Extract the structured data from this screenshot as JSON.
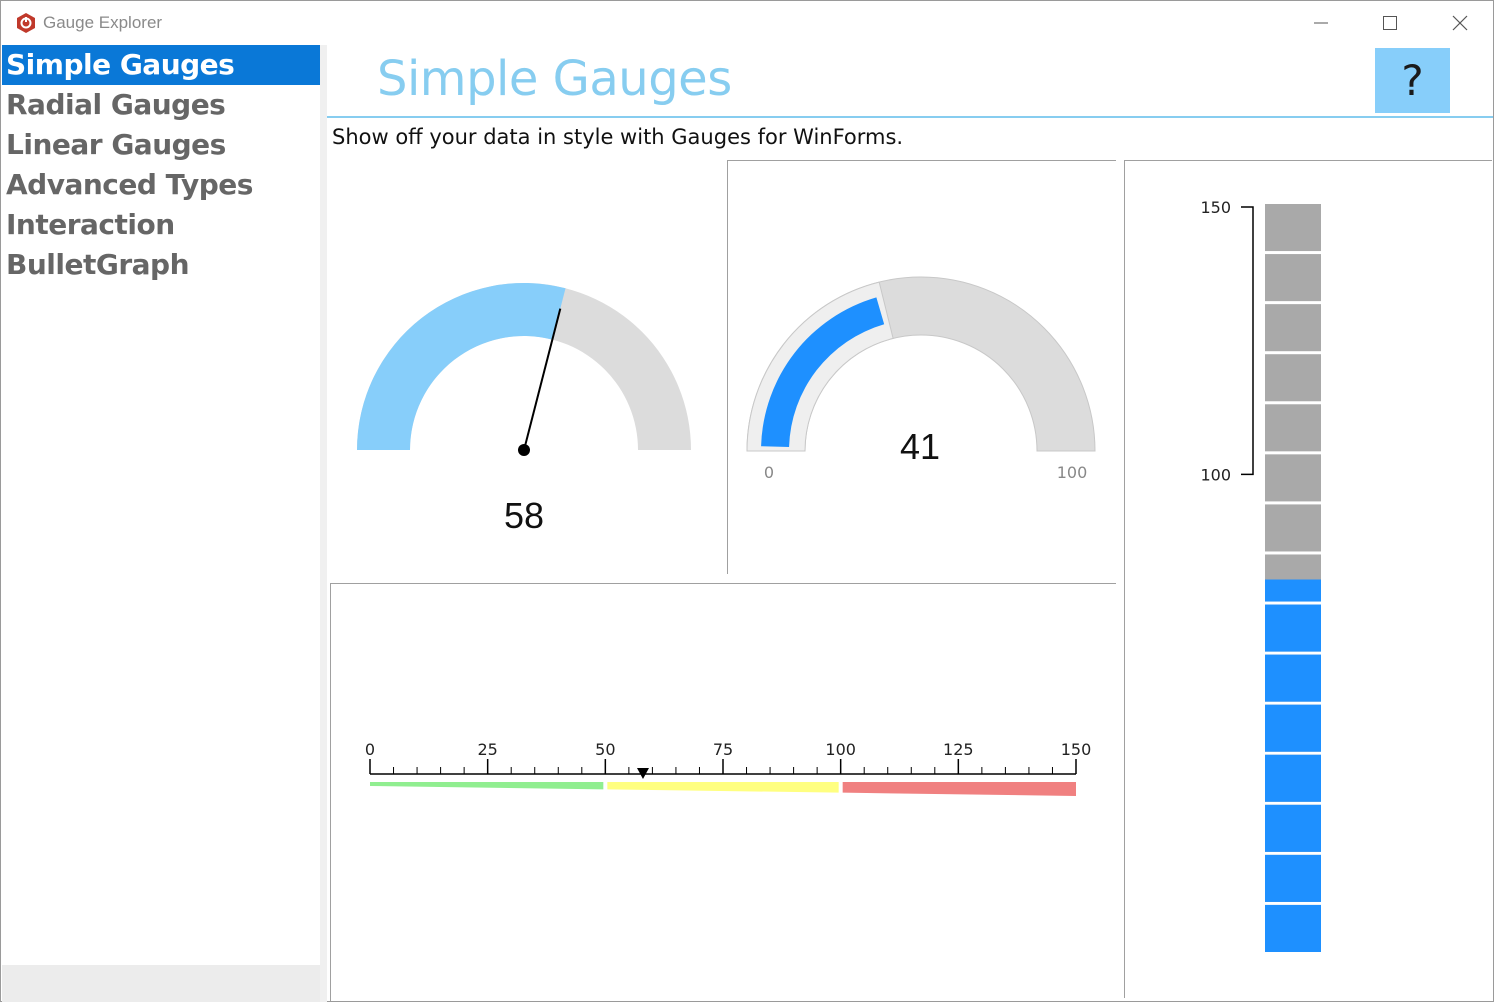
{
  "window": {
    "title": "Gauge Explorer",
    "controls": {
      "minimize": "–",
      "maximize": "☐",
      "close": "✕"
    }
  },
  "sidebar": {
    "items": [
      {
        "label": "Simple Gauges",
        "active": true
      },
      {
        "label": "Radial Gauges",
        "active": false
      },
      {
        "label": "Linear Gauges",
        "active": false
      },
      {
        "label": "Advanced Types",
        "active": false
      },
      {
        "label": "Interaction",
        "active": false
      },
      {
        "label": "BulletGraph",
        "active": false
      }
    ]
  },
  "header": {
    "title": "Simple Gauges",
    "help_label": "?",
    "subtitle": "Show off your data in style with Gauges for WinForms."
  },
  "colors": {
    "accent": "#0a78d7",
    "title": "#87cdf0",
    "gauge_light_blue": "#87cefa",
    "gauge_blue": "#1e90ff",
    "track_gray": "#dcdcdc",
    "segment_gray": "#a9a9a9",
    "range_green": "#90ee90",
    "range_yellow": "#ffff80",
    "range_red": "#f08080"
  },
  "gauges": {
    "radial_pointer": {
      "value": 58,
      "label": "58",
      "min": 0,
      "max": 100
    },
    "radial_bar": {
      "value": 41,
      "label": "41",
      "min": 0,
      "max": 100,
      "min_label": "0",
      "max_label": "100"
    },
    "linear": {
      "min": 0,
      "max": 150,
      "pointer": 58,
      "ticks": [
        "0",
        "25",
        "50",
        "75",
        "100",
        "125",
        "150"
      ],
      "ranges": [
        {
          "from": 0,
          "to": 50,
          "color": "#90ee90"
        },
        {
          "from": 50,
          "to": 100,
          "color": "#ffff80"
        },
        {
          "from": 100,
          "to": 150,
          "color": "#f08080"
        }
      ]
    },
    "vertical_bar": {
      "min": 0,
      "max": 150,
      "value": 75,
      "labels": [
        "150",
        "100"
      ],
      "segments": 15
    }
  }
}
